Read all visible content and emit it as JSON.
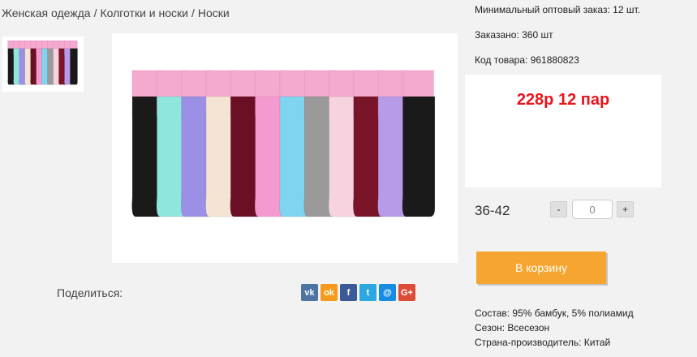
{
  "breadcrumb": {
    "items": [
      "Женская одежда",
      "Колготки и носки",
      "Носки"
    ],
    "separator": "/"
  },
  "product": {
    "min_order": "Минимальный оптовый заказ: 12 шт.",
    "ordered": "Заказано: 360 шт",
    "code": "Код товара: 961880823",
    "price": "228р 12 пар",
    "price_color": "#e8141c",
    "size": "36-42",
    "quantity": "0",
    "minus_label": "-",
    "plus_label": "+",
    "cart_button": "В корзину",
    "cart_color": "#f6a630",
    "composition": "Состав: 95% бамбук, 5% полиамид",
    "season": "Сезон: Всесезон",
    "country": "Страна-производитель: Китай"
  },
  "share": {
    "label": "Поделиться:",
    "icons": [
      {
        "name": "vk-icon",
        "glyph": "vk",
        "color": "#4c75a3"
      },
      {
        "name": "odnoklassniki-icon",
        "glyph": "ok",
        "color": "#f59a1c"
      },
      {
        "name": "facebook-icon",
        "glyph": "f",
        "color": "#3b5998"
      },
      {
        "name": "twitter-icon",
        "glyph": "t",
        "color": "#2ca7e0"
      },
      {
        "name": "mail-icon",
        "glyph": "@",
        "color": "#168de2"
      },
      {
        "name": "google-plus-icon",
        "glyph": "G+",
        "color": "#dd4b39"
      }
    ]
  },
  "socks": {
    "colors": [
      "#1a1a1a",
      "#8fe6dc",
      "#9b8fe6",
      "#f3e4d4",
      "#6b0f24",
      "#f59ad0",
      "#7fd4ef",
      "#9a9a9a",
      "#f7d3e0",
      "#7a1428",
      "#b79ae8",
      "#1a1a1a"
    ]
  }
}
